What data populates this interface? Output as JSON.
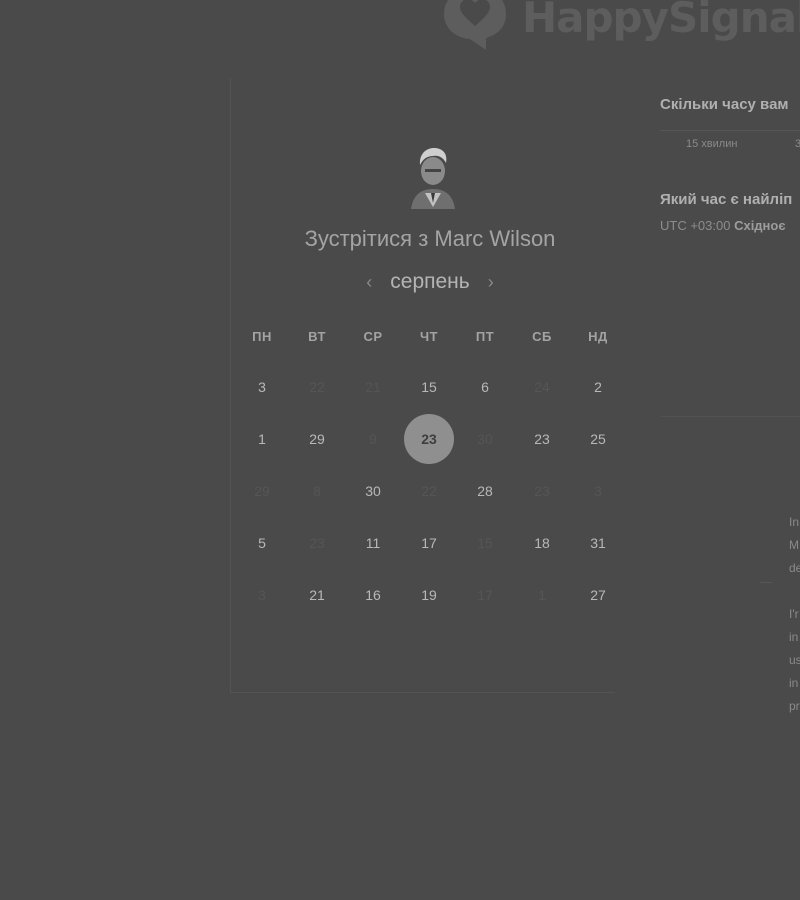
{
  "brand": {
    "name": "HappySignals"
  },
  "header": {
    "title_prefix": "Зустрітися з",
    "person_name": "Marc Wilson"
  },
  "calendar": {
    "month": "серпень",
    "prev_icon": "chevron-left-icon",
    "next_icon": "chevron-right-icon",
    "weekdays": [
      "ПН",
      "ВТ",
      "СР",
      "ЧТ",
      "ПТ",
      "СБ",
      "НД"
    ],
    "rows": [
      [
        "3",
        "22",
        "21",
        "15",
        "6",
        "24",
        "2"
      ],
      [
        "1",
        "29",
        "9",
        "23",
        "30",
        "23",
        "25"
      ],
      [
        "29",
        "8",
        "30",
        "22",
        "28",
        "23",
        "3"
      ],
      [
        "5",
        "23",
        "11",
        "17",
        "15",
        "18",
        "31"
      ],
      [
        "3",
        "21",
        "16",
        "19",
        "17",
        "1",
        "27"
      ]
    ],
    "disabled": [
      [
        false,
        true,
        true,
        false,
        false,
        true,
        false
      ],
      [
        false,
        false,
        true,
        false,
        true,
        false,
        false
      ],
      [
        true,
        true,
        false,
        true,
        false,
        true,
        true
      ],
      [
        false,
        true,
        false,
        false,
        true,
        false,
        false
      ],
      [
        true,
        false,
        false,
        false,
        true,
        true,
        false
      ]
    ],
    "selected": {
      "row": 1,
      "col": 3
    }
  },
  "duration": {
    "question": "Скільки часу вам",
    "options": [
      "15 хвилин",
      "3"
    ]
  },
  "timezone": {
    "question": "Який час є найліп",
    "offset": "UTC +03:00",
    "zone_name": "Східноє"
  },
  "testimonials": [
    {
      "lines": [
        "In",
        "M",
        "de"
      ]
    },
    {
      "lines": [
        "I'r",
        "in",
        "us",
        "in",
        "pr"
      ]
    }
  ],
  "colors": {
    "overlay": "#4a4a4a",
    "selected_day_bg": "#8f8f8f"
  }
}
